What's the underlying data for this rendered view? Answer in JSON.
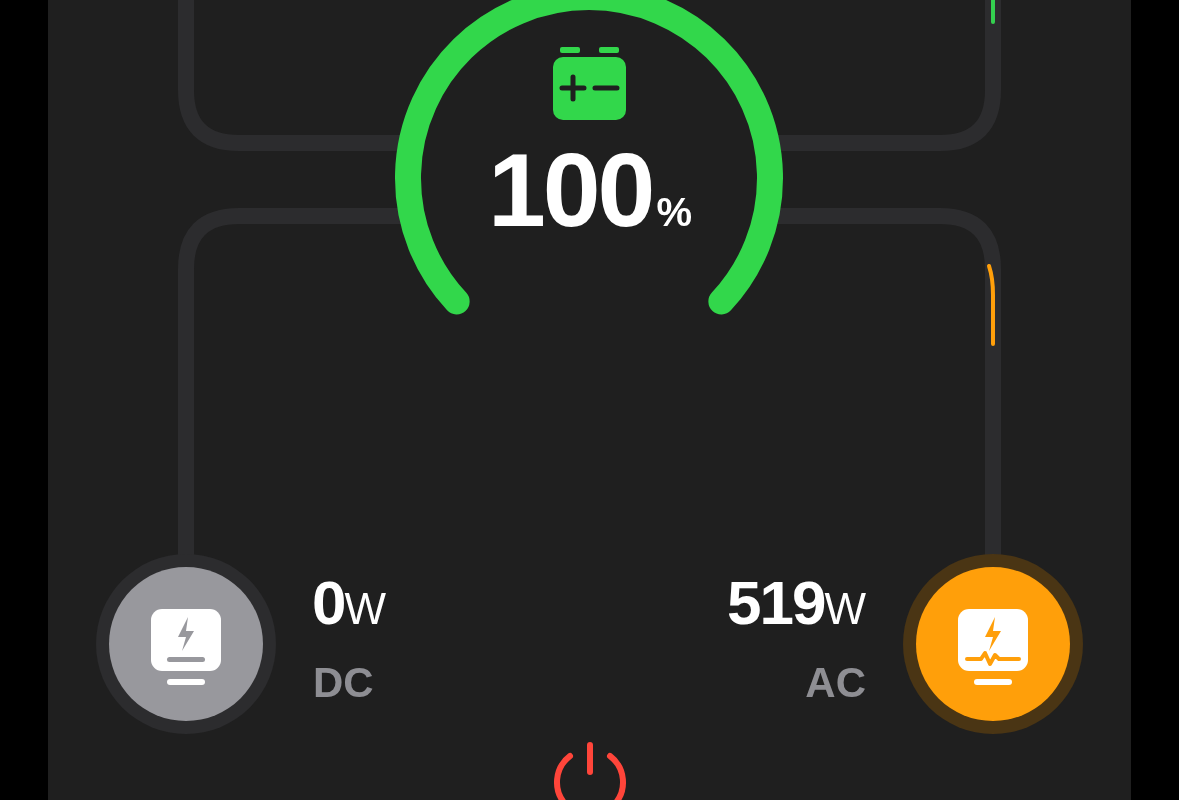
{
  "battery": {
    "value": "100",
    "unit": "%"
  },
  "outputs": [
    {
      "label": "DC",
      "value": "0",
      "unit": "W",
      "on": false
    },
    {
      "label": "AC",
      "value": "519",
      "unit": "W",
      "on": true
    }
  ]
}
